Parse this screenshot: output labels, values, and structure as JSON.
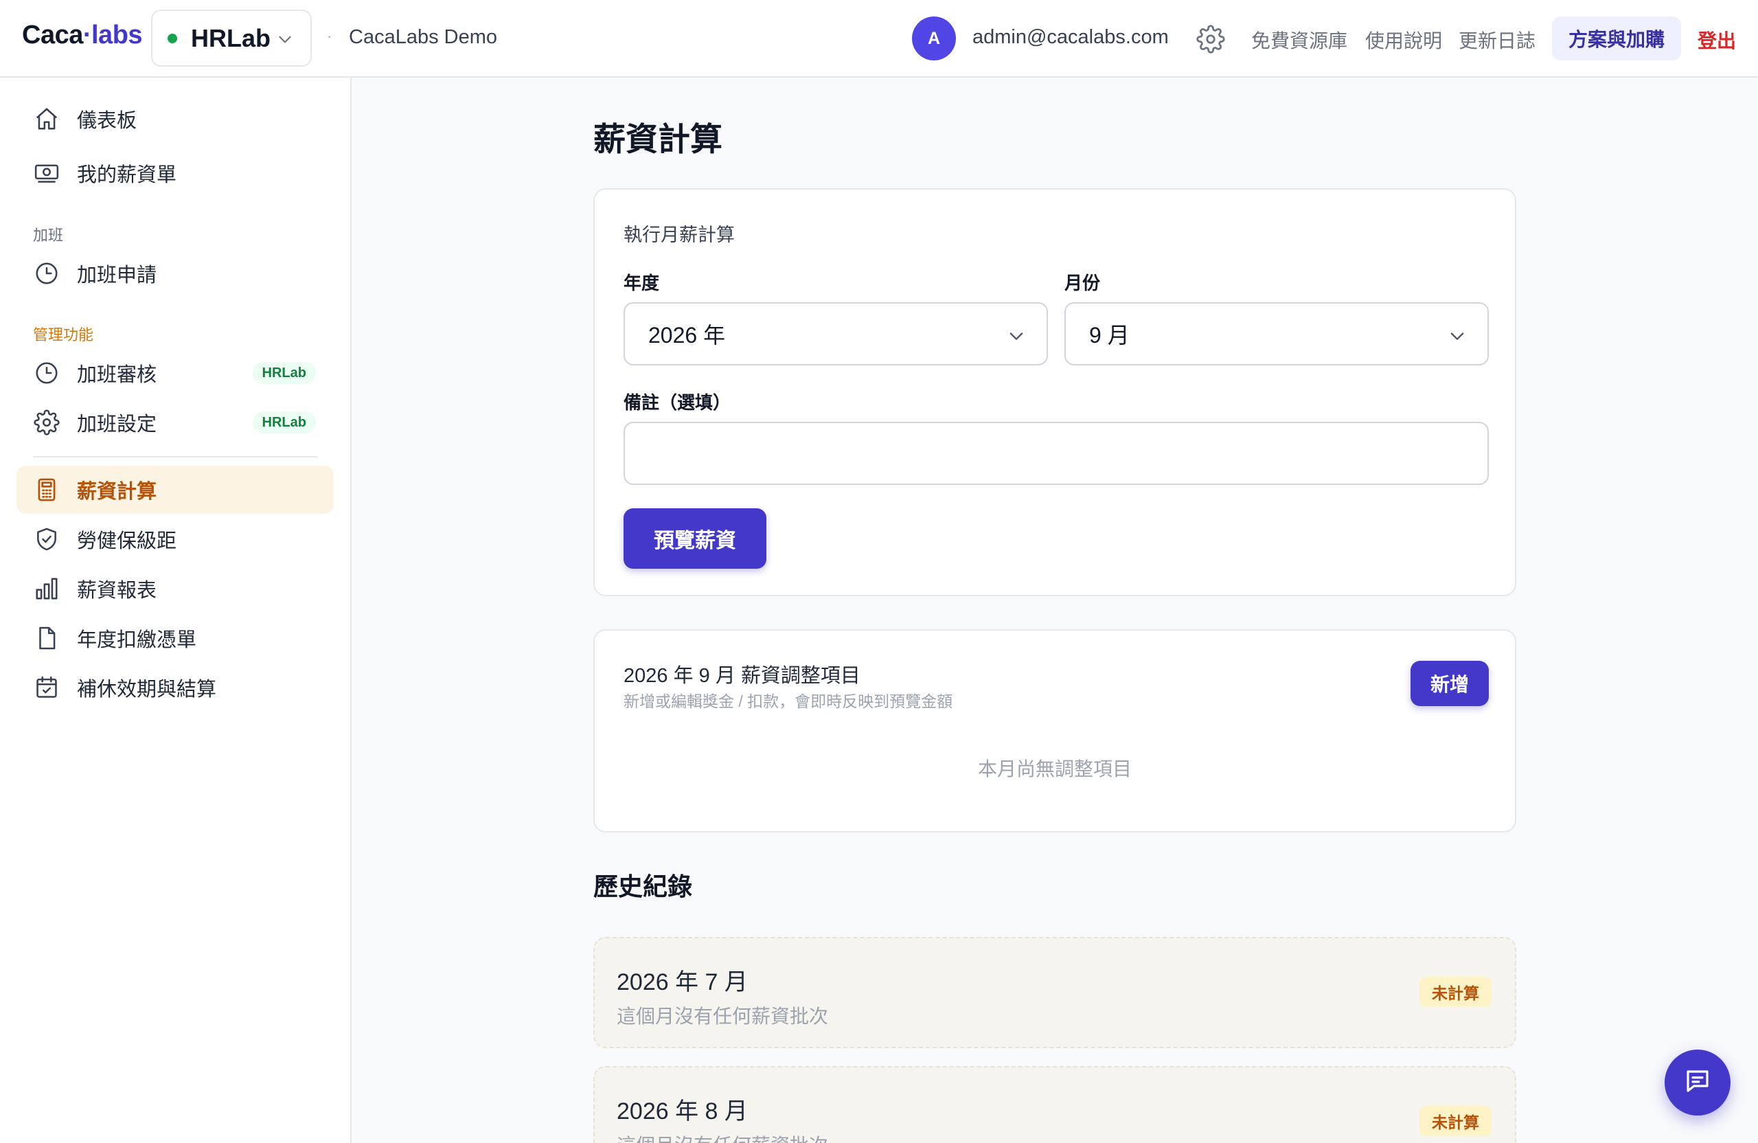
{
  "header": {
    "logo_left": "Caca",
    "logo_dot": "·",
    "logo_right": "labs",
    "app_name": "HRLab",
    "org_name": "CacaLabs Demo",
    "avatar_initial": "A",
    "email": "admin@cacalabs.com",
    "links": {
      "free_resources": "免費資源庫",
      "usage_guide": "使用說明",
      "changelog": "更新日誌"
    },
    "plan_button": "方案與加購",
    "logout": "登出"
  },
  "sidebar": {
    "items": {
      "dashboard": "儀表板",
      "my_payslips": "我的薪資單",
      "overtime_request": "加班申請",
      "overtime_review": "加班審核",
      "overtime_settings": "加班設定",
      "payroll_calc": "薪資計算",
      "insurance_grades": "勞健保級距",
      "payroll_reports": "薪資報表",
      "annual_withholding": "年度扣繳憑單",
      "comp_leave": "補休效期與結算"
    },
    "sections": {
      "overtime": "加班",
      "admin": "管理功能"
    },
    "badge": "HRLab",
    "colors": {
      "active_bg": "#fdf3e3",
      "active_text": "#b45309",
      "admin_section": "#d97706"
    }
  },
  "main": {
    "title": "薪資計算",
    "run_card": {
      "label": "執行月薪計算",
      "year_label": "年度",
      "year_value": "2026 年",
      "month_label": "月份",
      "month_value": "9 月",
      "note_label": "備註（選填）",
      "note_value": "",
      "preview_button": "預覽薪資"
    },
    "adjust_card": {
      "title": "2026 年 9 月 薪資調整項目",
      "subtitle": "新增或編輯獎金 / 扣款，會即時反映到預覽金額",
      "add_button": "新增",
      "empty": "本月尚無調整項目"
    },
    "history": {
      "title": "歷史紀錄",
      "entries": [
        {
          "month": "2026 年 7 月",
          "desc": "這個月沒有任何薪資批次",
          "status": "未計算"
        },
        {
          "month": "2026 年 8 月",
          "desc": "這個月沒有任何薪資批次",
          "status": "未計算"
        }
      ]
    }
  },
  "icons": {
    "chat": "chat-icon",
    "settings": "gear-icon"
  },
  "accent": "#4338ca"
}
